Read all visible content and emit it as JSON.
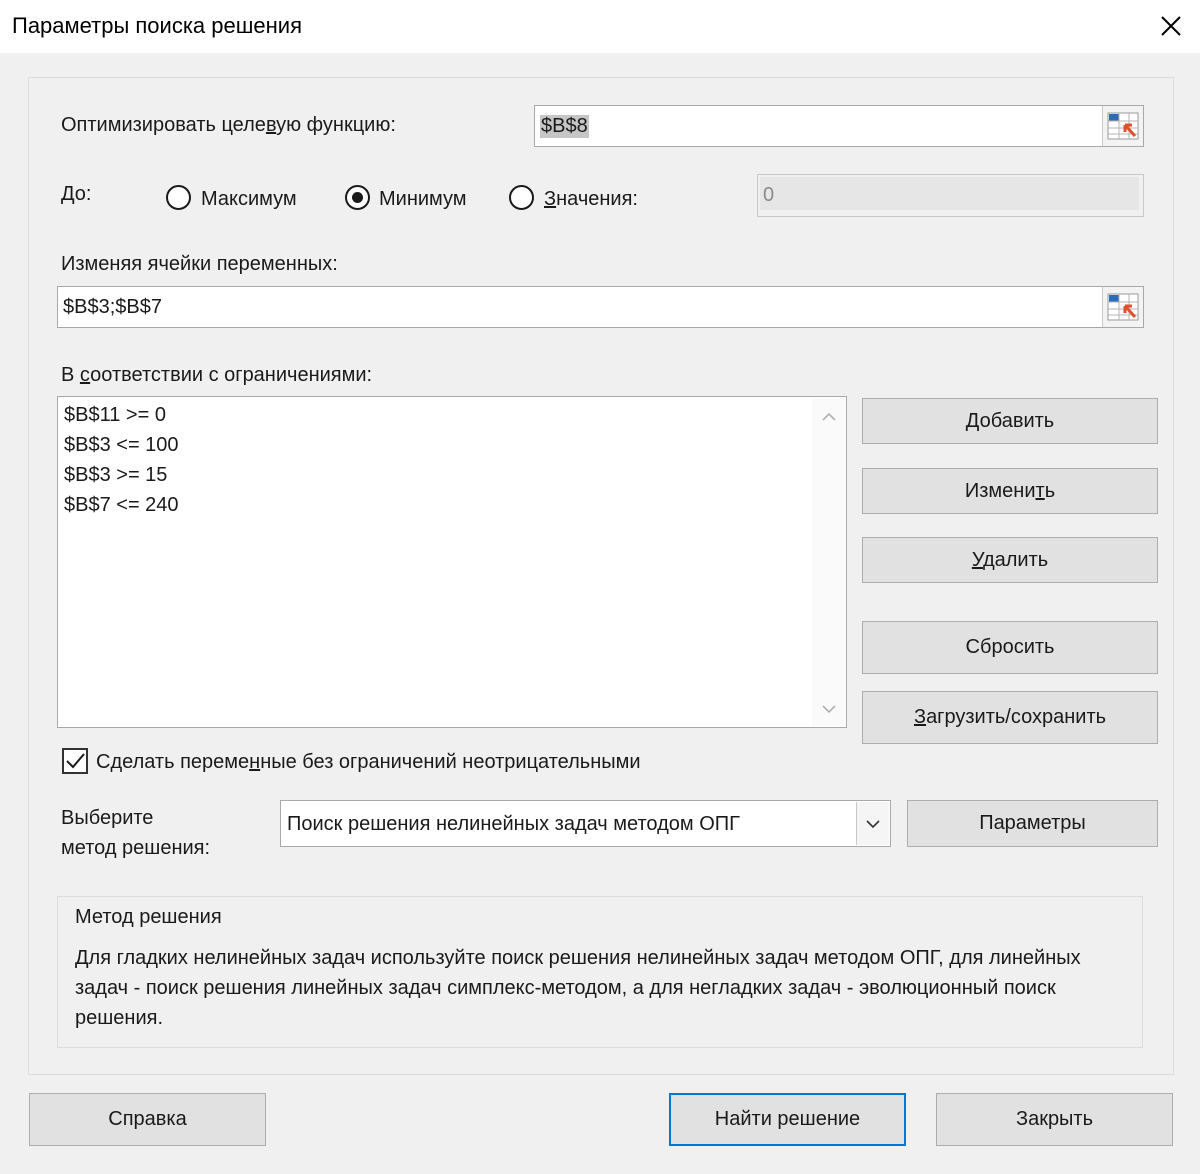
{
  "window": {
    "title": "Параметры поиска решения"
  },
  "objective": {
    "label": "Оптимизировать целевую функцию:",
    "value": "$B$8"
  },
  "to": {
    "label": "До:",
    "options": [
      {
        "label": "Максимум",
        "selected": false
      },
      {
        "label": "Минимум",
        "selected": true
      },
      {
        "label": "Значения:",
        "selected": false
      }
    ],
    "value_field": "0"
  },
  "variables": {
    "label": "Изменяя ячейки переменных:",
    "value": "$B$3;$B$7"
  },
  "constraints": {
    "label": "В соответствии с ограничениями:",
    "items": [
      "$B$11 >= 0",
      "$B$3 <= 100",
      "$B$3 >= 15",
      "$B$7 <= 240"
    ],
    "buttons": {
      "add": "Добавить",
      "change": "Изменить",
      "delete": "Удалить",
      "reset": "Сбросить",
      "load_save": "Загрузить/сохранить"
    }
  },
  "nonnegative": {
    "label": "Сделать переменные без ограничений неотрицательными",
    "checked": true
  },
  "method": {
    "label_line1": "Выберите",
    "label_line2": "метод решения:",
    "selected": "Поиск решения нелинейных задач методом ОПГ",
    "options_button": "Параметры"
  },
  "method_description": {
    "title": "Метод решения",
    "text": "Для гладких нелинейных задач используйте поиск решения нелинейных задач методом ОПГ, для линейных задач - поиск решения линейных задач симплекс-методом, а для негладких задач - эволюционный поиск решения."
  },
  "footer": {
    "help": "Справка",
    "solve": "Найти решение",
    "close": "Закрыть"
  },
  "colors": {
    "default_button_border": "#0078d7",
    "ref_icon_blue": "#2b6cb8",
    "ref_icon_red": "#e0502a"
  },
  "icons": {
    "close": "close-icon",
    "range_ref": "range-select-icon",
    "dropdown": "chevron-down-icon"
  }
}
